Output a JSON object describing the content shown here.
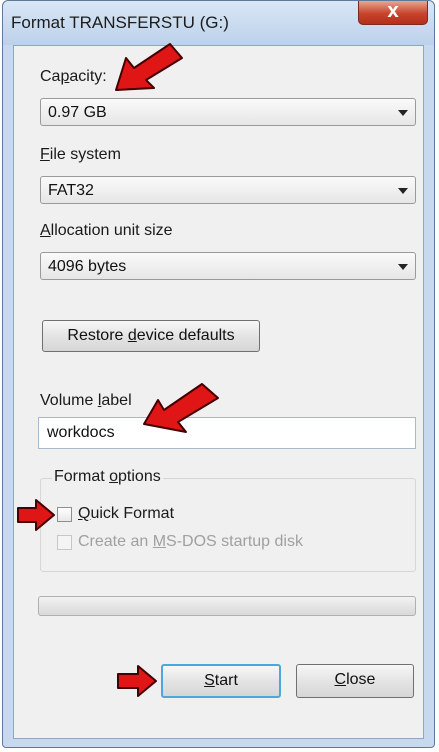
{
  "window": {
    "title": "Format TRANSFERSTU (G:)",
    "close_glyph": "X"
  },
  "capacity": {
    "label_pre": "Ca",
    "label_key": "p",
    "label_post": "acity:",
    "value": "0.97 GB"
  },
  "file_system": {
    "label_key": "F",
    "label_post": "ile system",
    "value": "FAT32"
  },
  "allocation": {
    "label_key": "A",
    "label_post": "llocation unit size",
    "value": "4096 bytes"
  },
  "restore_button": {
    "label_pre": "Restore ",
    "label_key": "d",
    "label_post": "evice defaults"
  },
  "volume_label": {
    "label_pre": "Volume ",
    "label_key": "l",
    "label_post": "abel",
    "value": "workdocs"
  },
  "format_options": {
    "title_pre": "Format ",
    "title_key": "o",
    "title_post": "ptions",
    "quick_format": {
      "label_key": "Q",
      "label_post": "uick Format",
      "checked": false
    },
    "msdos_disk": {
      "label_pre": "Create an ",
      "label_key": "M",
      "label_post": "S-DOS startup disk",
      "checked": false,
      "enabled": false
    }
  },
  "progress": {
    "fraction": 0
  },
  "buttons": {
    "start": {
      "label_key": "S",
      "label_post": "tart"
    },
    "close": {
      "label_key": "C",
      "label_post": "lose"
    }
  },
  "colors": {
    "annotation_arrow": "#e01515",
    "title_bar": "#c7d9ee",
    "close_button": "#c7432b"
  }
}
